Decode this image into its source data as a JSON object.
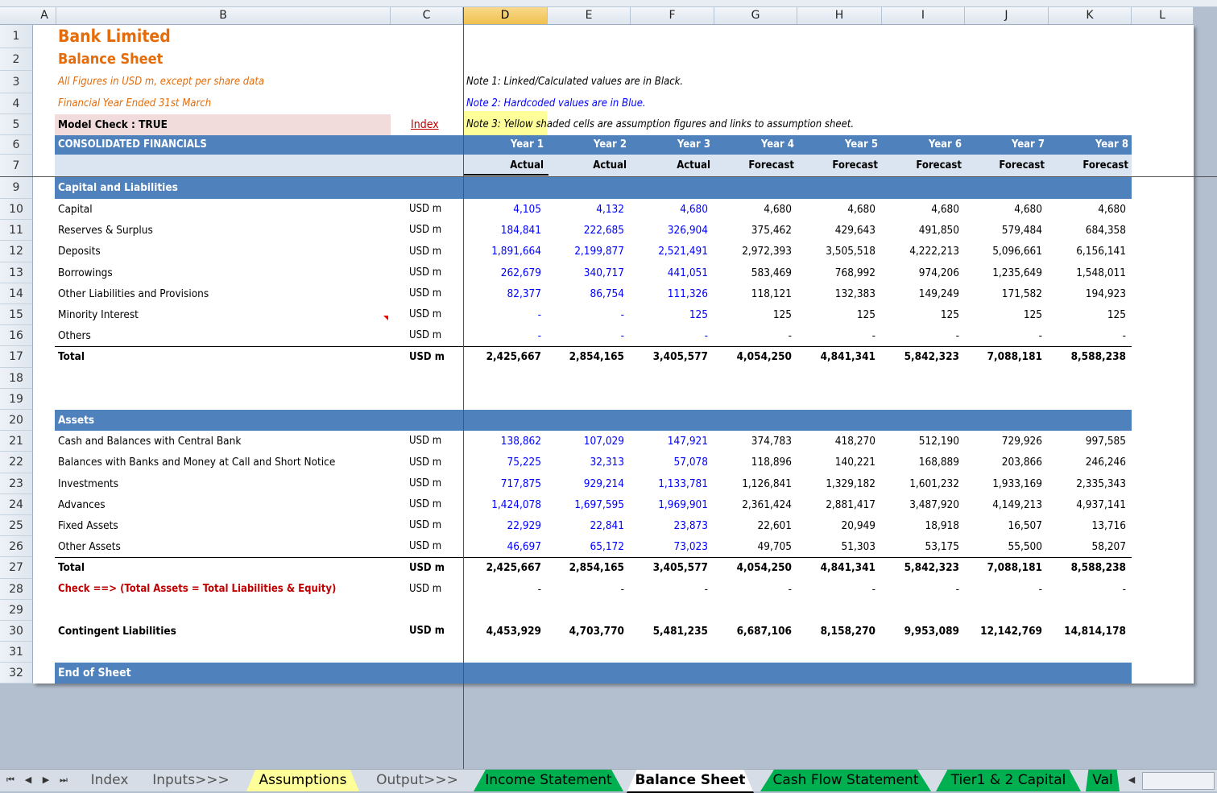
{
  "columns": [
    "A",
    "B",
    "C",
    "D",
    "E",
    "F",
    "G",
    "H",
    "I",
    "J",
    "K",
    "L"
  ],
  "row_numbers": [
    "1",
    "2",
    "3",
    "4",
    "5",
    "6",
    "7",
    "9",
    "10",
    "11",
    "12",
    "13",
    "14",
    "15",
    "16",
    "17",
    "18",
    "19",
    "20",
    "21",
    "22",
    "23",
    "24",
    "25",
    "26",
    "27",
    "28",
    "29",
    "30",
    "31",
    "32"
  ],
  "header": {
    "company": "Bank Limited",
    "sheet_title": "Balance Sheet",
    "units_note": "All Figures in USD m, except per share data",
    "fy_note": "Financial Year Ended 31st March",
    "model_check": "Model Check : TRUE",
    "index_link": "Index",
    "note1": "Note 1: Linked/Calculated values are in Black.",
    "note2": "Note 2: Hardcoded values are in Blue.",
    "note3_highlight": "Note 3: Yellow",
    "note3_rest": " shaded cells are assumption figures and links to assumption sheet.",
    "section_label": "CONSOLIDATED FINANCIALS",
    "years": [
      "Year 1",
      "Year 2",
      "Year 3",
      "Year 4",
      "Year 5",
      "Year 6",
      "Year 7",
      "Year 8"
    ],
    "types": [
      "Actual",
      "Actual",
      "Actual",
      "Forecast",
      "Forecast",
      "Forecast",
      "Forecast",
      "Forecast"
    ]
  },
  "sections": {
    "liabilities": "Capital and Liabilities",
    "assets": "Assets",
    "end": "End of Sheet"
  },
  "liabilities_rows": [
    {
      "label": "Capital",
      "unit": "USD m",
      "values": [
        "4,105",
        "4,132",
        "4,680",
        "4,680",
        "4,680",
        "4,680",
        "4,680",
        "4,680"
      ]
    },
    {
      "label": "Reserves & Surplus",
      "unit": "USD m",
      "values": [
        "184,841",
        "222,685",
        "326,904",
        "375,462",
        "429,643",
        "491,850",
        "579,484",
        "684,358"
      ]
    },
    {
      "label": "Deposits",
      "unit": "USD m",
      "values": [
        "1,891,664",
        "2,199,877",
        "2,521,491",
        "2,972,393",
        "3,505,518",
        "4,222,213",
        "5,096,661",
        "6,156,141"
      ]
    },
    {
      "label": "Borrowings",
      "unit": "USD m",
      "values": [
        "262,679",
        "340,717",
        "441,051",
        "583,469",
        "768,992",
        "974,206",
        "1,235,649",
        "1,548,011"
      ]
    },
    {
      "label": "Other Liabilities and Provisions",
      "unit": "USD m",
      "values": [
        "82,377",
        "86,754",
        "111,326",
        "118,121",
        "132,383",
        "149,249",
        "171,582",
        "194,923"
      ]
    },
    {
      "label": "Minority Interest",
      "unit": "USD m",
      "values": [
        "-",
        "-",
        "125",
        "125",
        "125",
        "125",
        "125",
        "125"
      ]
    },
    {
      "label": "Others",
      "unit": "USD m",
      "values": [
        "-",
        "-",
        "-",
        "-",
        "-",
        "-",
        "-",
        "-"
      ]
    }
  ],
  "liabilities_total": {
    "label": "Total",
    "unit": "USD m",
    "values": [
      "2,425,667",
      "2,854,165",
      "3,405,577",
      "4,054,250",
      "4,841,341",
      "5,842,323",
      "7,088,181",
      "8,588,238"
    ]
  },
  "assets_rows": [
    {
      "label": "Cash and Balances with Central Bank",
      "unit": "USD m",
      "values": [
        "138,862",
        "107,029",
        "147,921",
        "374,783",
        "418,270",
        "512,190",
        "729,926",
        "997,585"
      ]
    },
    {
      "label": "Balances with Banks and Money at Call and Short Notice",
      "unit": "USD m",
      "values": [
        "75,225",
        "32,313",
        "57,078",
        "118,896",
        "140,221",
        "168,889",
        "203,866",
        "246,246"
      ]
    },
    {
      "label": "Investments",
      "unit": "USD m",
      "values": [
        "717,875",
        "929,214",
        "1,133,781",
        "1,126,841",
        "1,329,182",
        "1,601,232",
        "1,933,169",
        "2,335,343"
      ]
    },
    {
      "label": "Advances",
      "unit": "USD m",
      "values": [
        "1,424,078",
        "1,697,595",
        "1,969,901",
        "2,361,424",
        "2,881,417",
        "3,487,920",
        "4,149,213",
        "4,937,141"
      ]
    },
    {
      "label": "Fixed Assets",
      "unit": "USD m",
      "values": [
        "22,929",
        "22,841",
        "23,873",
        "22,601",
        "20,949",
        "18,918",
        "16,507",
        "13,716"
      ]
    },
    {
      "label": "Other Assets",
      "unit": "USD m",
      "values": [
        "46,697",
        "65,172",
        "73,023",
        "49,705",
        "51,303",
        "53,175",
        "55,500",
        "58,207"
      ]
    }
  ],
  "assets_total": {
    "label": "Total",
    "unit": "USD m",
    "values": [
      "2,425,667",
      "2,854,165",
      "3,405,577",
      "4,054,250",
      "4,841,341",
      "5,842,323",
      "7,088,181",
      "8,588,238"
    ]
  },
  "check_row": {
    "label": "Check ==> (Total Assets = Total Liabilities & Equity)",
    "unit": "USD m",
    "values": [
      "-",
      "-",
      "-",
      "-",
      "-",
      "-",
      "-",
      "-"
    ]
  },
  "contingent": {
    "label": "Contingent Liabilities",
    "unit": "USD m",
    "values": [
      "4,453,929",
      "4,703,770",
      "5,481,235",
      "6,687,106",
      "8,158,270",
      "9,953,089",
      "12,142,769",
      "14,814,178"
    ]
  },
  "sheet_tabs": [
    "Index",
    "Inputs>>>",
    "Assumptions",
    "Output>>>",
    "Income Statement",
    "Balance Sheet",
    "Cash Flow Statement",
    "Tier1 & 2 Capital",
    "Val"
  ],
  "colors": {
    "band": "#4f81bd",
    "orange": "#e46c0a",
    "blue": "#0000ff",
    "dark_red": "#c00000",
    "green_tab": "#00b050",
    "yellow_tab": "#ffff99"
  }
}
